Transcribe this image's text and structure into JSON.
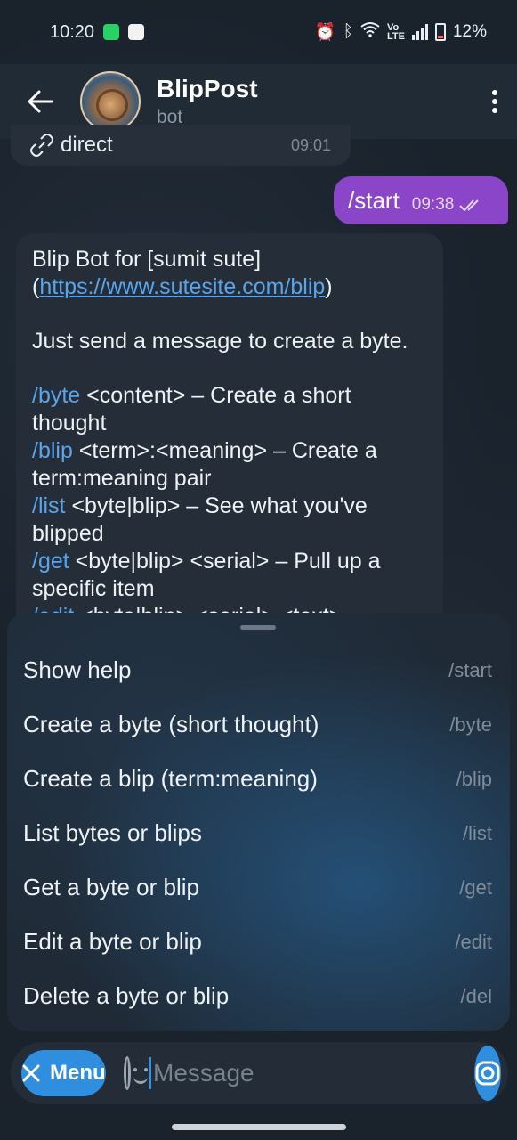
{
  "status_bar": {
    "time": "10:20",
    "battery": "12%",
    "icons": [
      "whatsapp-icon",
      "slack-icon",
      "alarm-icon",
      "bluetooth-icon",
      "wifi-icon",
      "volte-icon",
      "signal-icon",
      "battery-icon"
    ]
  },
  "header": {
    "title": "BlipPost",
    "subtitle": "bot"
  },
  "messages": {
    "prev": {
      "text": "direct",
      "time": "09:01"
    },
    "outgoing": {
      "text": "/start",
      "time": "09:38"
    },
    "bot": {
      "intro_prefix": "Blip Bot for [sumit sute](",
      "intro_link": "https://www.sutesite.com/blip",
      "intro_suffix": ")",
      "line2": "Just send a message to create a byte.",
      "commands": [
        {
          "cmd": "/byte",
          "text": " <content> – Create a short thought"
        },
        {
          "cmd": "/blip",
          "text": " <term>:<meaning> – Create a term:meaning pair"
        },
        {
          "cmd": "/list",
          "text": " <byte|blip> – See what you've blipped"
        },
        {
          "cmd": "/get",
          "text": " <byte|blip> <serial> – Pull up a specific item"
        },
        {
          "cmd": "/edit",
          "text": " <byte|blip> <serial> <text>"
        }
      ]
    }
  },
  "command_menu": [
    {
      "label": "Show help",
      "command": "/start"
    },
    {
      "label": "Create a byte (short thought)",
      "command": "/byte"
    },
    {
      "label": "Create a blip (term:meaning)",
      "command": "/blip"
    },
    {
      "label": "List bytes or blips",
      "command": "/list"
    },
    {
      "label": "Get a byte or blip",
      "command": "/get"
    },
    {
      "label": "Edit a byte or blip",
      "command": "/edit"
    },
    {
      "label": "Delete a byte or blip",
      "command": "/del"
    }
  ],
  "input_bar": {
    "menu_label": "Menu",
    "placeholder": "Message"
  },
  "colors": {
    "accent": "#2f8fde",
    "outgoing_bubble": "#8b45c9",
    "link": "#5aa4ea"
  }
}
